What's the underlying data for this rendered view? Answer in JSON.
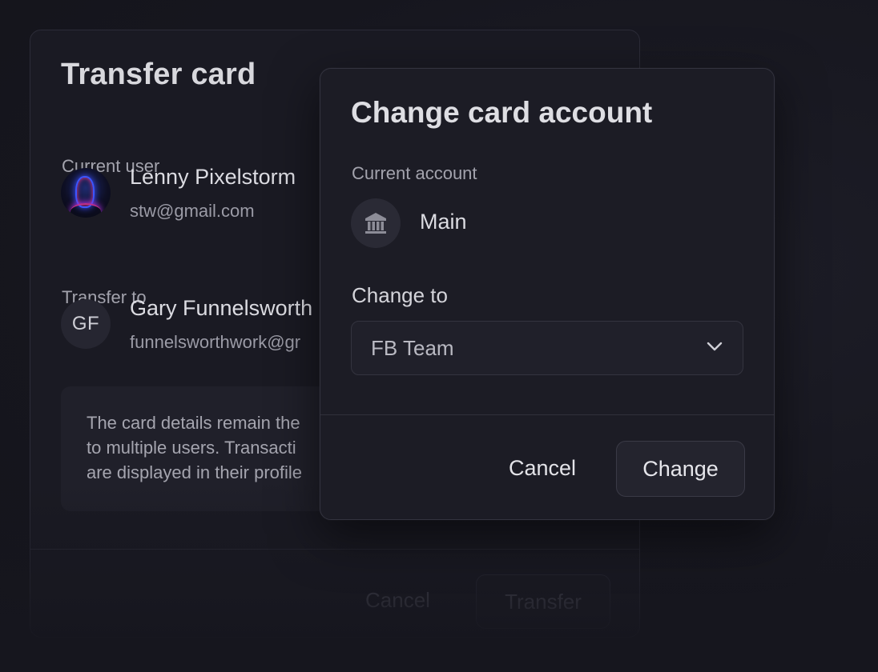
{
  "transfer_dialog": {
    "title": "Transfer card",
    "current_user_label": "Current user",
    "current_user": {
      "name": "Lenny Pixelstorm",
      "email": "stw@gmail.com"
    },
    "transfer_to_label": "Transfer to",
    "transfer_user": {
      "initials": "GF",
      "name": "Gary Funnelsworth",
      "email": "funnelsworthwork@gr"
    },
    "info_lines": [
      "The card details remain the",
      "to multiple users. Transacti",
      "are displayed in their profile"
    ],
    "cancel_label": "Cancel",
    "transfer_label": "Transfer"
  },
  "change_dialog": {
    "title": "Change card account",
    "current_account_label": "Current account",
    "current_account": {
      "icon": "bank-icon",
      "name": "Main"
    },
    "change_to_label": "Change to",
    "select": {
      "value": "FB Team",
      "icon": "chevron-down-icon"
    },
    "cancel_label": "Cancel",
    "change_label": "Change"
  }
}
